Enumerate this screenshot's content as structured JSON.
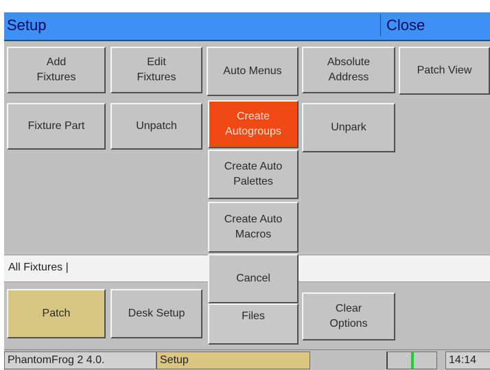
{
  "window": {
    "title": "Setup",
    "close_label": "Close"
  },
  "buttons": {
    "add_fixtures": "Add\nFixtures",
    "edit_fixtures": "Edit\nFixtures",
    "auto_menus": "Auto Menus",
    "absolute_address": "Absolute\nAddress",
    "patch_view": "Patch View",
    "fixture_part": "Fixture Part",
    "unpatch": "Unpatch",
    "create_autogroups": "Create\nAutogroups",
    "unpark": "Unpark",
    "create_auto_palettes": "Create Auto\nPalettes",
    "create_auto_macros": "Create Auto\nMacros",
    "cancel": "Cancel",
    "patch": "Patch",
    "desk_setup": "Desk Setup",
    "files": "Files",
    "clear_options": "Clear\nOptions"
  },
  "command_line": {
    "text": "All Fixtures |"
  },
  "status_bar": {
    "version": "PhantomFrog 2 4.0.",
    "mode": "Setup",
    "clock": "14:14"
  },
  "colors": {
    "title_bar": "#3f90f4",
    "highlight_button": "#f04a14",
    "selected_button": "#d6c681",
    "meter": "#22d022"
  }
}
